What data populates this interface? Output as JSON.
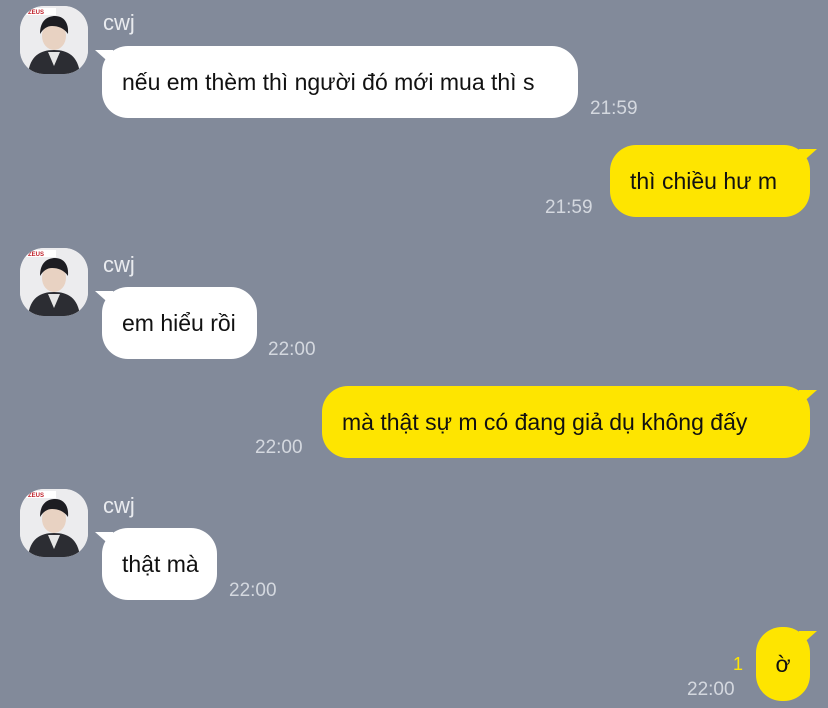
{
  "messages": [
    {
      "sender": "cwj",
      "text": "nếu em thèm thì người đó mới mua thì s",
      "time": "21:59"
    },
    {
      "text": "thì chiều hư m",
      "time": "21:59"
    },
    {
      "sender": "cwj",
      "text": "em hiểu rồi",
      "time": "22:00"
    },
    {
      "text": "mà thật sự m có đang giả dụ không đấy",
      "time": "22:00"
    },
    {
      "sender": "cwj",
      "text": "thật mà",
      "time": "22:00"
    },
    {
      "text": "ờ",
      "time": "22:00",
      "unread_count": "1"
    }
  ],
  "avatar_badge": "ZEUS",
  "colors": {
    "background": "#828a9a",
    "incoming_bubble": "#ffffff",
    "outgoing_bubble": "#fee500",
    "unread_count": "#fee500"
  }
}
